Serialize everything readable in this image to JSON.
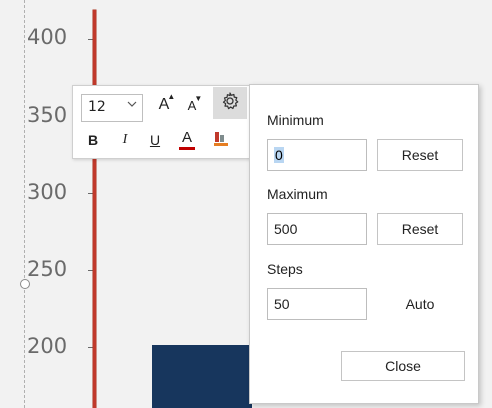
{
  "chart": {
    "y_ticks": [
      "400",
      "350",
      "300",
      "250",
      "200"
    ]
  },
  "toolbar": {
    "font_size": "12",
    "grow_font_icon": "A",
    "shrink_font_icon": "A",
    "bold_label": "B",
    "italic_label": "I",
    "underline_label": "U",
    "font_color_label": "A"
  },
  "panel": {
    "minimum_label": "Minimum",
    "minimum_value": "0",
    "minimum_reset": "Reset",
    "maximum_label": "Maximum",
    "maximum_value": "500",
    "maximum_reset": "Reset",
    "steps_label": "Steps",
    "steps_value": "50",
    "steps_auto": "Auto",
    "close_label": "Close"
  },
  "colors": {
    "axis_line": "#c0392b",
    "bar": "#17365d",
    "selection_highlight": "#b9d6f2",
    "font_color_underline": "#c00000"
  }
}
